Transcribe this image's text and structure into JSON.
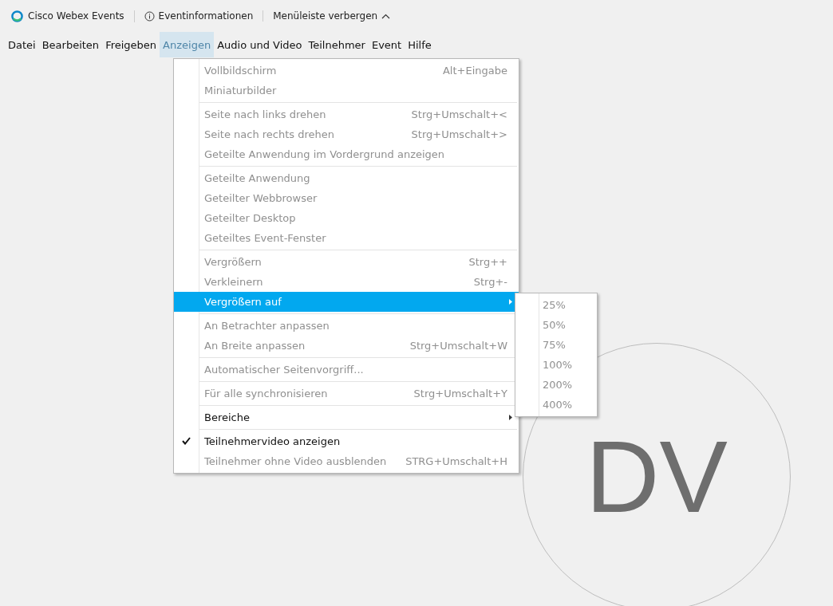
{
  "title_bar": {
    "app_name": "Cisco Webex Events",
    "info_button": "Eventinformationen",
    "hide_menu_button": "Menüleiste verbergen"
  },
  "menu_bar": [
    {
      "label": "Datei",
      "selected": false
    },
    {
      "label": "Bearbeiten",
      "selected": false
    },
    {
      "label": "Freigeben",
      "selected": false
    },
    {
      "label": "Anzeigen",
      "selected": true
    },
    {
      "label": "Audio und Video",
      "selected": false
    },
    {
      "label": "Teilnehmer",
      "selected": false
    },
    {
      "label": "Event",
      "selected": false
    },
    {
      "label": "Hilfe",
      "selected": false
    }
  ],
  "dropdown_menu": {
    "groups": [
      [
        {
          "label": "Vollbildschirm",
          "shortcut": "Alt+Eingabe",
          "disabled": true,
          "selected": false,
          "checked": false,
          "submenu": false
        },
        {
          "label": "Miniaturbilder",
          "disabled": true,
          "selected": false,
          "checked": false,
          "submenu": false
        }
      ],
      [
        {
          "label": "Seite nach links drehen",
          "shortcut": "Strg+Umschalt+<",
          "disabled": true,
          "selected": false,
          "checked": false,
          "submenu": false
        },
        {
          "label": "Seite nach rechts drehen",
          "shortcut": "Strg+Umschalt+>",
          "disabled": true,
          "selected": false,
          "checked": false,
          "submenu": false
        },
        {
          "label": "Geteilte Anwendung im Vordergrund anzeigen",
          "disabled": true,
          "selected": false,
          "checked": false,
          "submenu": false
        }
      ],
      [
        {
          "label": "Geteilte Anwendung",
          "disabled": true,
          "selected": false,
          "checked": false,
          "submenu": false
        },
        {
          "label": "Geteilter Webbrowser",
          "disabled": true,
          "selected": false,
          "checked": false,
          "submenu": false
        },
        {
          "label": "Geteilter Desktop",
          "disabled": true,
          "selected": false,
          "checked": false,
          "submenu": false
        },
        {
          "label": "Geteiltes Event-Fenster",
          "disabled": true,
          "selected": false,
          "checked": false,
          "submenu": false
        }
      ],
      [
        {
          "label": "Vergrößern",
          "shortcut": "Strg++",
          "disabled": true,
          "selected": false,
          "checked": false,
          "submenu": false
        },
        {
          "label": "Verkleinern",
          "shortcut": "Strg+-",
          "disabled": true,
          "selected": false,
          "checked": false,
          "submenu": false
        },
        {
          "label": "Vergrößern auf",
          "disabled": false,
          "selected": true,
          "checked": false,
          "submenu": true
        }
      ],
      [
        {
          "label": "An Betrachter anpassen",
          "disabled": true,
          "selected": false,
          "checked": false,
          "submenu": false
        },
        {
          "label": "An Breite anpassen",
          "shortcut": "Strg+Umschalt+W",
          "disabled": true,
          "selected": false,
          "checked": false,
          "submenu": false
        }
      ],
      [
        {
          "label": "Automatischer Seitenvorgriff...",
          "disabled": true,
          "selected": false,
          "checked": false,
          "submenu": false
        }
      ],
      [
        {
          "label": "Für alle synchronisieren",
          "shortcut": "Strg+Umschalt+Y",
          "disabled": true,
          "selected": false,
          "checked": false,
          "submenu": false
        }
      ],
      [
        {
          "label": "Bereiche",
          "disabled": false,
          "selected": false,
          "checked": false,
          "submenu": true
        }
      ],
      [
        {
          "label": "Teilnehmervideo anzeigen",
          "disabled": false,
          "selected": false,
          "checked": true,
          "submenu": false
        },
        {
          "label": "Teilnehmer ohne Video ausblenden",
          "shortcut": "STRG+Umschalt+H",
          "disabled": true,
          "selected": false,
          "checked": false,
          "submenu": false
        }
      ]
    ]
  },
  "submenu": [
    {
      "label": "25%",
      "disabled": true
    },
    {
      "label": "50%",
      "disabled": true
    },
    {
      "label": "75%",
      "disabled": true
    },
    {
      "label": "100%",
      "disabled": true
    },
    {
      "label": "200%",
      "disabled": true
    },
    {
      "label": "400%",
      "disabled": true
    }
  ],
  "avatar": {
    "initials": "DV"
  }
}
